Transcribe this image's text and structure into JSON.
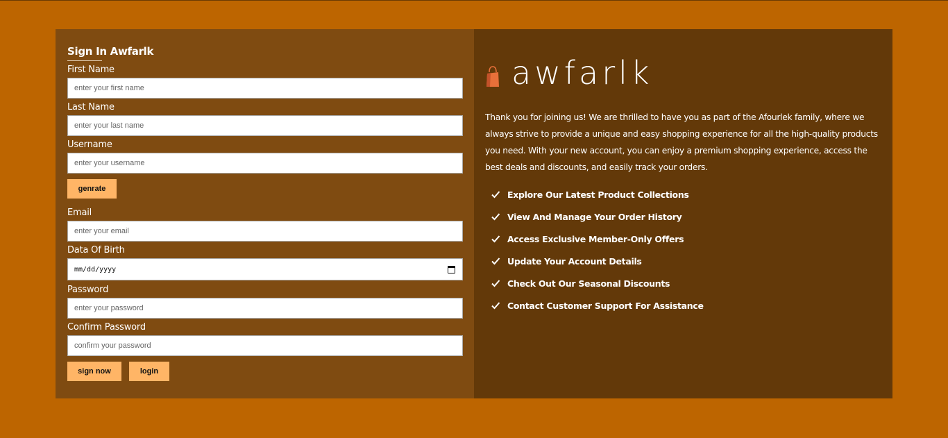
{
  "form": {
    "title": "Sign In Awfarlk",
    "fields": {
      "first_name": {
        "label": "First Name",
        "placeholder": "enter your first name"
      },
      "last_name": {
        "label": "Last Name",
        "placeholder": "enter your last name"
      },
      "username": {
        "label": "Username",
        "placeholder": "enter your username"
      },
      "email": {
        "label": "Email",
        "placeholder": "enter your email"
      },
      "dob": {
        "label": "Data Of Birth",
        "placeholder": "mm/dd/yyyy"
      },
      "password": {
        "label": "Password",
        "placeholder": "enter your password"
      },
      "confirm_password": {
        "label": "Confirm Password",
        "placeholder": "confirm your password"
      }
    },
    "generate_label": "genrate",
    "sign_label": "sign now",
    "login_label": "login"
  },
  "info": {
    "brand": "awfarlk",
    "intro": "Thank you for joining us! We are thrilled to have you as part of the Afourlek family, where we always strive to provide a unique and easy shopping experience for all the high-quality products you need. With your new account, you can enjoy a premium shopping experience, access the best deals and discounts, and easily track your orders.",
    "features": [
      "Explore Our Latest Product Collections",
      "View And Manage Your Order History",
      "Access Exclusive Member-Only Offers",
      "Update Your Account Details",
      "Check Out Our Seasonal Discounts",
      "Contact Customer Support For Assistance"
    ]
  },
  "colors": {
    "page_bg": "#bd6500",
    "form_bg": "#7f4b11",
    "info_bg": "#633909",
    "button_bg": "#ffb566",
    "logo_accent": "#e8703a"
  },
  "icons": {
    "logo": "shopping-bag-icon",
    "feature": "check-icon",
    "date": "calendar-icon"
  }
}
